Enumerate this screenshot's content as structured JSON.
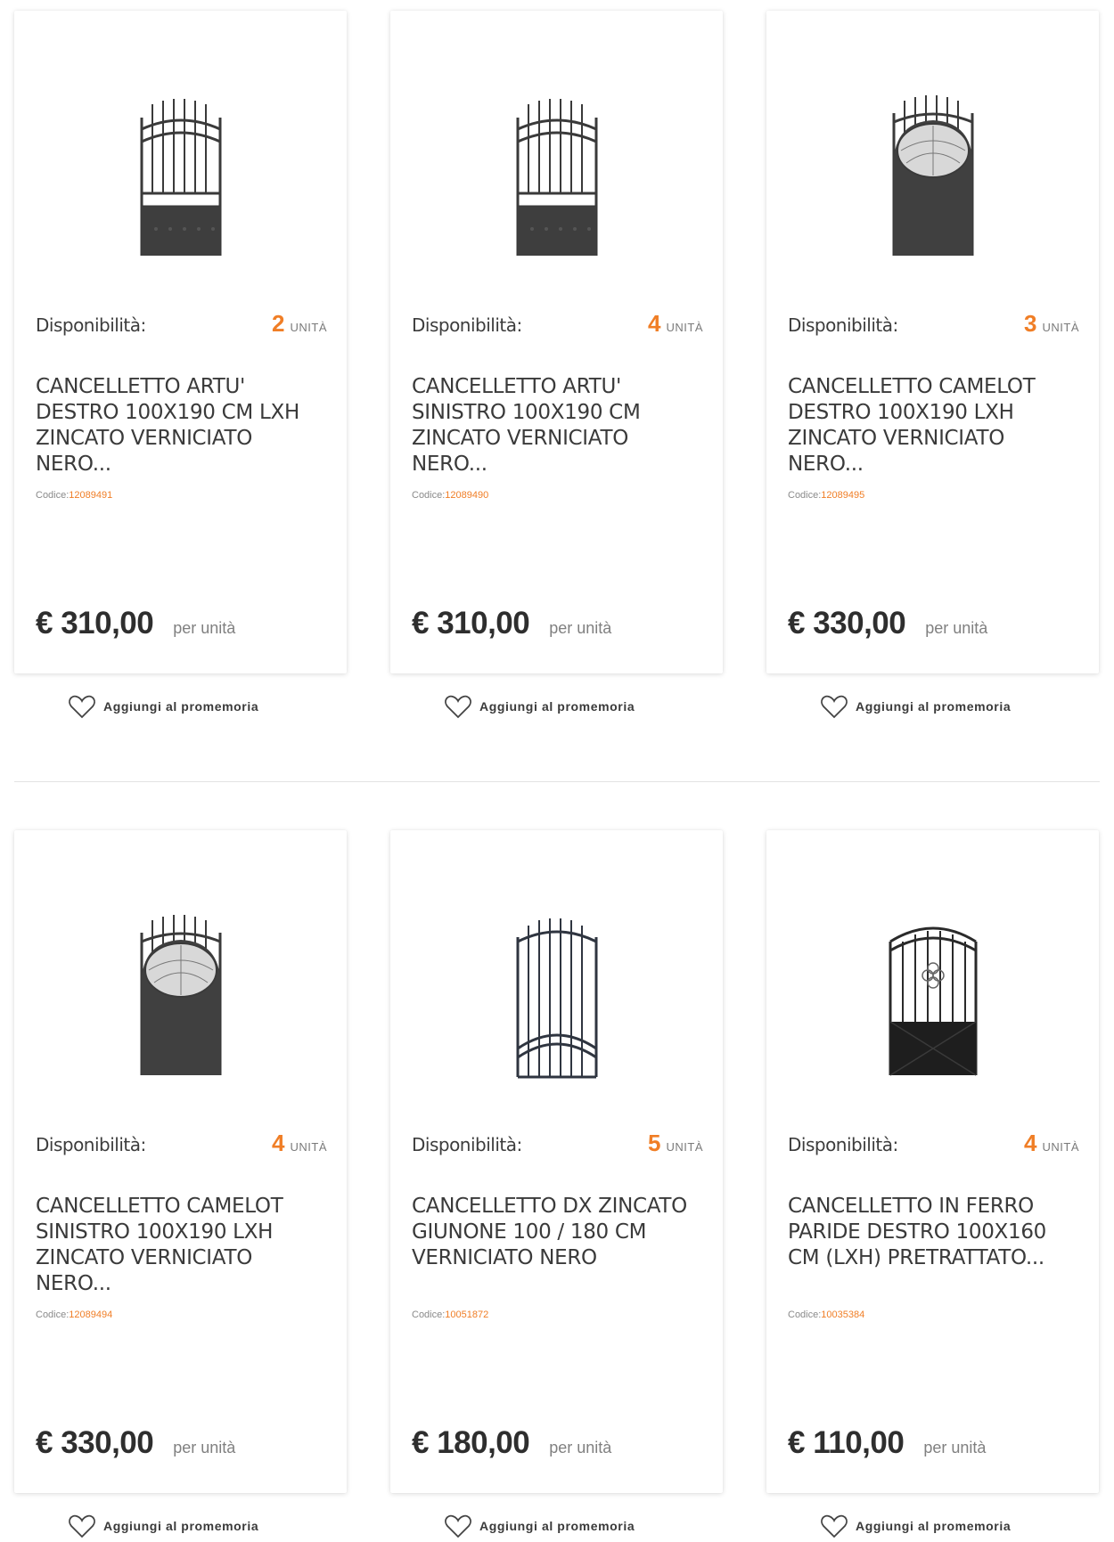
{
  "common": {
    "availability_label": "Disponibilità:",
    "unit_label": "UNITÀ",
    "code_label": "Codice:",
    "per_unit_label": "per unità",
    "wishlist_label": "Aggiungi al promemoria",
    "accent_color": "#f07e26"
  },
  "products": [
    {
      "qty": "2",
      "title": "CANCELLETTO ARTU' DESTRO 100X190 CM LXH ZINCATO VERNICIATO NERO...",
      "code": "12089491",
      "price": "€ 310,00",
      "image_icon": "gate-artu-icon"
    },
    {
      "qty": "4",
      "title": "CANCELLETTO ARTU' SINISTRO 100X190 CM ZINCATO VERNICIATO NERO...",
      "code": "12089490",
      "price": "€ 310,00",
      "image_icon": "gate-artu-icon"
    },
    {
      "qty": "3",
      "title": "CANCELLETTO CAMELOT DESTRO 100X190 LXH ZINCATO VERNICIATO NERO...",
      "code": "12089495",
      "price": "€ 330,00",
      "image_icon": "gate-camelot-icon"
    },
    {
      "qty": "4",
      "title": "CANCELLETTO CAMELOT SINISTRO 100X190 LXH ZINCATO VERNICIATO NERO...",
      "code": "12089494",
      "price": "€ 330,00",
      "image_icon": "gate-camelot-icon"
    },
    {
      "qty": "5",
      "title": "CANCELLETTO DX ZINCATO GIUNONE 100 / 180 CM VERNICIATO NERO",
      "code": "10051872",
      "price": "€ 180,00",
      "image_icon": "gate-giunone-icon"
    },
    {
      "qty": "4",
      "title": "CANCELLETTO IN FERRO PARIDE DESTRO 100X160 CM (LXH) PRETRATTATO...",
      "code": "10035384",
      "price": "€ 110,00",
      "image_icon": "gate-paride-icon"
    }
  ]
}
